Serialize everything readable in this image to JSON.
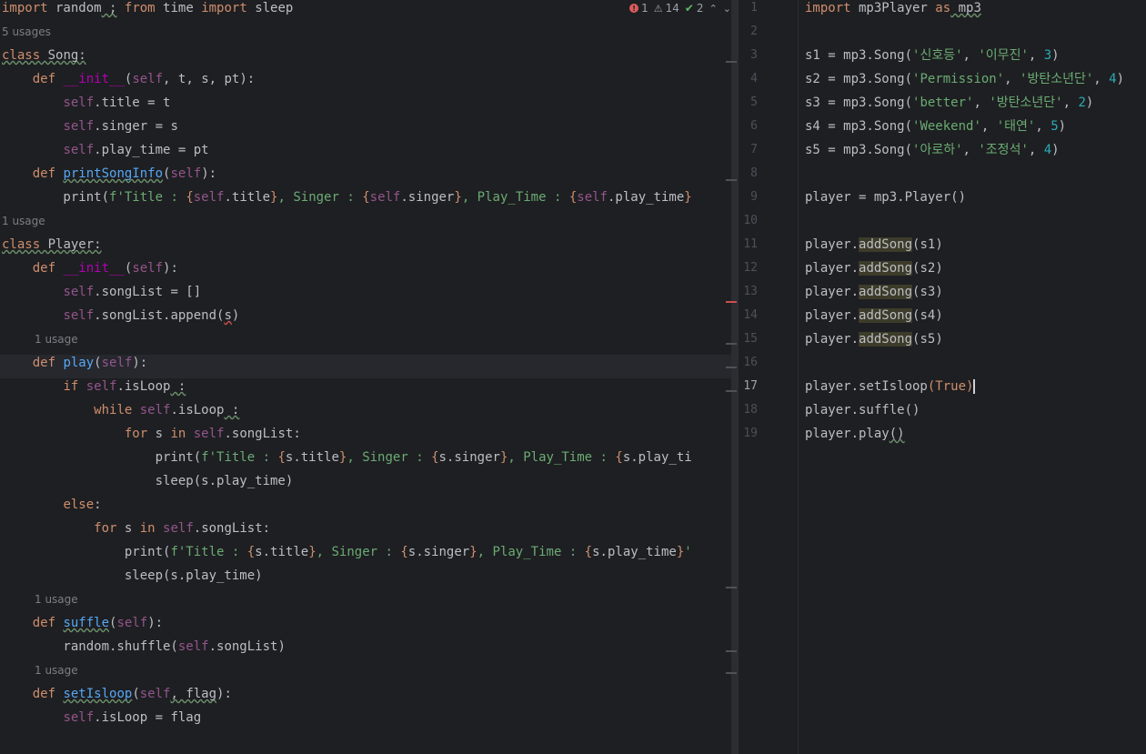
{
  "left_editor": {
    "inspection": {
      "errors": "1",
      "warnings": "14",
      "weak_warnings": "2"
    },
    "lines": [
      {
        "kind": "code",
        "tokens": [
          [
            "kw",
            "import"
          ],
          [
            "plain",
            " random"
          ],
          [
            "squig",
            " ;"
          ],
          [
            "plain",
            " "
          ],
          [
            "kw",
            "from"
          ],
          [
            "plain",
            " time "
          ],
          [
            "kw",
            "import"
          ],
          [
            "plain",
            " sleep"
          ]
        ]
      },
      {
        "kind": "hint",
        "text": "5 usages"
      },
      {
        "kind": "code",
        "tokens": [
          [
            "kw-squig",
            "class"
          ],
          [
            "plain-squig",
            " Song:"
          ]
        ]
      },
      {
        "kind": "code",
        "tokens": [
          [
            "plain",
            "    "
          ],
          [
            "kw",
            "def"
          ],
          [
            "plain",
            " "
          ],
          [
            "dunder",
            "__init__"
          ],
          [
            "plain",
            "("
          ],
          [
            "self",
            "self"
          ],
          [
            "plain",
            ", t, s, pt):"
          ]
        ]
      },
      {
        "kind": "code",
        "tokens": [
          [
            "plain",
            "        "
          ],
          [
            "self",
            "self"
          ],
          [
            "plain",
            ".title = t"
          ]
        ]
      },
      {
        "kind": "code",
        "tokens": [
          [
            "plain",
            "        "
          ],
          [
            "self",
            "self"
          ],
          [
            "plain",
            ".singer = s"
          ]
        ]
      },
      {
        "kind": "code",
        "tokens": [
          [
            "plain",
            "        "
          ],
          [
            "self",
            "self"
          ],
          [
            "plain",
            ".play_time = pt"
          ]
        ]
      },
      {
        "kind": "code",
        "tokens": [
          [
            "plain",
            "    "
          ],
          [
            "kw",
            "def"
          ],
          [
            "plain",
            " "
          ],
          [
            "fn-squig",
            "printSongInfo"
          ],
          [
            "plain",
            "("
          ],
          [
            "self",
            "self"
          ],
          [
            "plain",
            "):"
          ]
        ]
      },
      {
        "kind": "code",
        "tokens": [
          [
            "plain",
            "        print("
          ],
          [
            "str",
            "f'Title : "
          ],
          [
            "brace",
            "{"
          ],
          [
            "self",
            "self"
          ],
          [
            "plain",
            ".title"
          ],
          [
            "brace",
            "}"
          ],
          [
            "str",
            ", Singer : "
          ],
          [
            "brace",
            "{"
          ],
          [
            "self",
            "self"
          ],
          [
            "plain",
            ".singer"
          ],
          [
            "brace",
            "}"
          ],
          [
            "str",
            ", Play_Time : "
          ],
          [
            "brace",
            "{"
          ],
          [
            "self",
            "self"
          ],
          [
            "plain",
            ".play_time"
          ],
          [
            "brace",
            "}"
          ]
        ]
      },
      {
        "kind": "hint",
        "text": "1 usage"
      },
      {
        "kind": "code",
        "tokens": [
          [
            "kw-squig",
            "class"
          ],
          [
            "plain-squig",
            " Player:"
          ]
        ]
      },
      {
        "kind": "code",
        "tokens": [
          [
            "plain",
            "    "
          ],
          [
            "kw",
            "def"
          ],
          [
            "plain",
            " "
          ],
          [
            "dunder",
            "__init__"
          ],
          [
            "plain",
            "("
          ],
          [
            "self",
            "self"
          ],
          [
            "plain",
            "):"
          ]
        ]
      },
      {
        "kind": "code",
        "tokens": [
          [
            "plain",
            "        "
          ],
          [
            "self",
            "self"
          ],
          [
            "plain",
            ".songList = []"
          ]
        ]
      },
      {
        "kind": "code",
        "tokens": [
          [
            "plain",
            "        "
          ],
          [
            "self",
            "self"
          ],
          [
            "plain",
            ".songList.append("
          ],
          [
            "plain-squig-red",
            "s"
          ],
          [
            "plain",
            ")"
          ]
        ]
      },
      {
        "kind": "hint",
        "text": "1 usage",
        "indent": "    "
      },
      {
        "kind": "code",
        "current": true,
        "tokens": [
          [
            "plain",
            "    "
          ],
          [
            "kw",
            "def"
          ],
          [
            "plain",
            " "
          ],
          [
            "fn",
            "play"
          ],
          [
            "plain",
            "("
          ],
          [
            "self",
            "self"
          ],
          [
            "plain",
            "):"
          ]
        ]
      },
      {
        "kind": "code",
        "tokens": [
          [
            "plain",
            "        "
          ],
          [
            "kw",
            "if"
          ],
          [
            "plain",
            " "
          ],
          [
            "self",
            "self"
          ],
          [
            "plain",
            ".isLoop"
          ],
          [
            "squig",
            " :"
          ]
        ]
      },
      {
        "kind": "code",
        "tokens": [
          [
            "plain",
            "            "
          ],
          [
            "kw",
            "while"
          ],
          [
            "plain",
            " "
          ],
          [
            "self",
            "self"
          ],
          [
            "plain",
            ".isLoop"
          ],
          [
            "squig",
            " :"
          ]
        ]
      },
      {
        "kind": "code",
        "tokens": [
          [
            "plain",
            "                "
          ],
          [
            "kw",
            "for"
          ],
          [
            "plain",
            " s "
          ],
          [
            "kw",
            "in"
          ],
          [
            "plain",
            " "
          ],
          [
            "self",
            "self"
          ],
          [
            "plain",
            ".songList:"
          ]
        ]
      },
      {
        "kind": "code",
        "tokens": [
          [
            "plain",
            "                    print("
          ],
          [
            "str",
            "f'Title : "
          ],
          [
            "brace",
            "{"
          ],
          [
            "plain",
            "s.title"
          ],
          [
            "brace",
            "}"
          ],
          [
            "str",
            ", Singer : "
          ],
          [
            "brace",
            "{"
          ],
          [
            "plain",
            "s.singer"
          ],
          [
            "brace",
            "}"
          ],
          [
            "str",
            ", Play_Time : "
          ],
          [
            "brace",
            "{"
          ],
          [
            "plain",
            "s.play_ti"
          ]
        ]
      },
      {
        "kind": "code",
        "tokens": [
          [
            "plain",
            "                    sleep(s.play_time)"
          ]
        ]
      },
      {
        "kind": "code",
        "tokens": [
          [
            "plain",
            "        "
          ],
          [
            "kw",
            "else"
          ],
          [
            "plain",
            ":"
          ]
        ]
      },
      {
        "kind": "code",
        "tokens": [
          [
            "plain",
            "            "
          ],
          [
            "kw",
            "for"
          ],
          [
            "plain",
            " s "
          ],
          [
            "kw",
            "in"
          ],
          [
            "plain",
            " "
          ],
          [
            "self",
            "self"
          ],
          [
            "plain",
            ".songList:"
          ]
        ]
      },
      {
        "kind": "code",
        "tokens": [
          [
            "plain",
            "                print("
          ],
          [
            "str",
            "f'Title : "
          ],
          [
            "brace",
            "{"
          ],
          [
            "plain",
            "s.title"
          ],
          [
            "brace",
            "}"
          ],
          [
            "str",
            ", Singer : "
          ],
          [
            "brace",
            "{"
          ],
          [
            "plain",
            "s.singer"
          ],
          [
            "brace",
            "}"
          ],
          [
            "str",
            ", Play_Time : "
          ],
          [
            "brace",
            "{"
          ],
          [
            "plain",
            "s.play_time"
          ],
          [
            "brace",
            "}"
          ],
          [
            "str",
            "'"
          ]
        ]
      },
      {
        "kind": "code",
        "tokens": [
          [
            "plain",
            "                sleep(s.play_time)"
          ]
        ]
      },
      {
        "kind": "hint",
        "text": "1 usage",
        "indent": "    "
      },
      {
        "kind": "code",
        "tokens": [
          [
            "plain",
            "    "
          ],
          [
            "kw",
            "def"
          ],
          [
            "plain",
            " "
          ],
          [
            "fn-squig",
            "suffle"
          ],
          [
            "plain",
            "("
          ],
          [
            "self",
            "self"
          ],
          [
            "plain",
            "):"
          ]
        ]
      },
      {
        "kind": "code",
        "tokens": [
          [
            "plain",
            "        random.shuffle("
          ],
          [
            "self",
            "self"
          ],
          [
            "plain",
            ".songList)"
          ]
        ]
      },
      {
        "kind": "hint",
        "text": "1 usage",
        "indent": "    "
      },
      {
        "kind": "code",
        "tokens": [
          [
            "plain",
            "    "
          ],
          [
            "kw",
            "def"
          ],
          [
            "plain",
            " "
          ],
          [
            "fn-squig",
            "setIsloop"
          ],
          [
            "plain",
            "("
          ],
          [
            "self",
            "self"
          ],
          [
            "plain-squig",
            ", flag"
          ],
          [
            "plain",
            "):"
          ]
        ]
      },
      {
        "kind": "code",
        "tokens": [
          [
            "plain",
            "        "
          ],
          [
            "self",
            "self"
          ],
          [
            "plain",
            ".isLoop = flag"
          ]
        ]
      }
    ]
  },
  "right_editor": {
    "line_numbers": [
      "1",
      "2",
      "3",
      "4",
      "5",
      "6",
      "7",
      "8",
      "9",
      "10",
      "11",
      "12",
      "13",
      "14",
      "15",
      "16",
      "17",
      "18",
      "19"
    ],
    "active_line": "17",
    "lines": [
      [
        [
          "kw",
          "import"
        ],
        [
          "plain",
          " mp3Player "
        ],
        [
          "kw",
          "as"
        ],
        [
          "plain-squig",
          " mp3"
        ]
      ],
      [],
      [
        [
          "plain",
          "s1 = mp3.Song("
        ],
        [
          "str",
          "'신호등'"
        ],
        [
          "plain",
          ", "
        ],
        [
          "str",
          "'이무진'"
        ],
        [
          "plain",
          ", "
        ],
        [
          "num",
          "3"
        ],
        [
          "plain",
          ")"
        ]
      ],
      [
        [
          "plain",
          "s2 = mp3.Song("
        ],
        [
          "str",
          "'Permission'"
        ],
        [
          "plain",
          ", "
        ],
        [
          "str",
          "'방탄소년단'"
        ],
        [
          "plain",
          ", "
        ],
        [
          "num",
          "4"
        ],
        [
          "plain",
          ")"
        ]
      ],
      [
        [
          "plain",
          "s3 = mp3.Song("
        ],
        [
          "str",
          "'better'"
        ],
        [
          "plain",
          ", "
        ],
        [
          "str",
          "'방탄소년단'"
        ],
        [
          "plain",
          ", "
        ],
        [
          "num",
          "2"
        ],
        [
          "plain",
          ")"
        ]
      ],
      [
        [
          "plain",
          "s4 = mp3.Song("
        ],
        [
          "str",
          "'Weekend'"
        ],
        [
          "plain",
          ", "
        ],
        [
          "str",
          "'태연'"
        ],
        [
          "plain",
          ", "
        ],
        [
          "num",
          "5"
        ],
        [
          "plain",
          ")"
        ]
      ],
      [
        [
          "plain",
          "s5 = mp3.Song("
        ],
        [
          "str",
          "'아로하'"
        ],
        [
          "plain",
          ", "
        ],
        [
          "str",
          "'조정석'"
        ],
        [
          "plain",
          ", "
        ],
        [
          "num",
          "4"
        ],
        [
          "plain",
          ")"
        ]
      ],
      [],
      [
        [
          "plain",
          "player = mp3.Player()"
        ]
      ],
      [],
      [
        [
          "plain",
          "player."
        ],
        [
          "hl",
          "addSong"
        ],
        [
          "plain",
          "(s1)"
        ]
      ],
      [
        [
          "plain",
          "player."
        ],
        [
          "hl",
          "addSong"
        ],
        [
          "plain",
          "(s2)"
        ]
      ],
      [
        [
          "plain",
          "player."
        ],
        [
          "hl",
          "addSong"
        ],
        [
          "plain",
          "(s3)"
        ]
      ],
      [
        [
          "plain",
          "player."
        ],
        [
          "hl",
          "addSong"
        ],
        [
          "plain",
          "(s4)"
        ]
      ],
      [
        [
          "plain",
          "player."
        ],
        [
          "hl",
          "addSong"
        ],
        [
          "plain",
          "(s5)"
        ]
      ],
      [],
      [
        [
          "plain",
          "player.setIsloop"
        ],
        [
          "brace",
          "("
        ],
        [
          "kw",
          "True"
        ],
        [
          "caret",
          ")"
        ]
      ],
      [
        [
          "plain",
          "player.suffle()"
        ]
      ],
      [
        [
          "plain",
          "player.play"
        ],
        [
          "plain-squig",
          "()"
        ]
      ]
    ]
  }
}
